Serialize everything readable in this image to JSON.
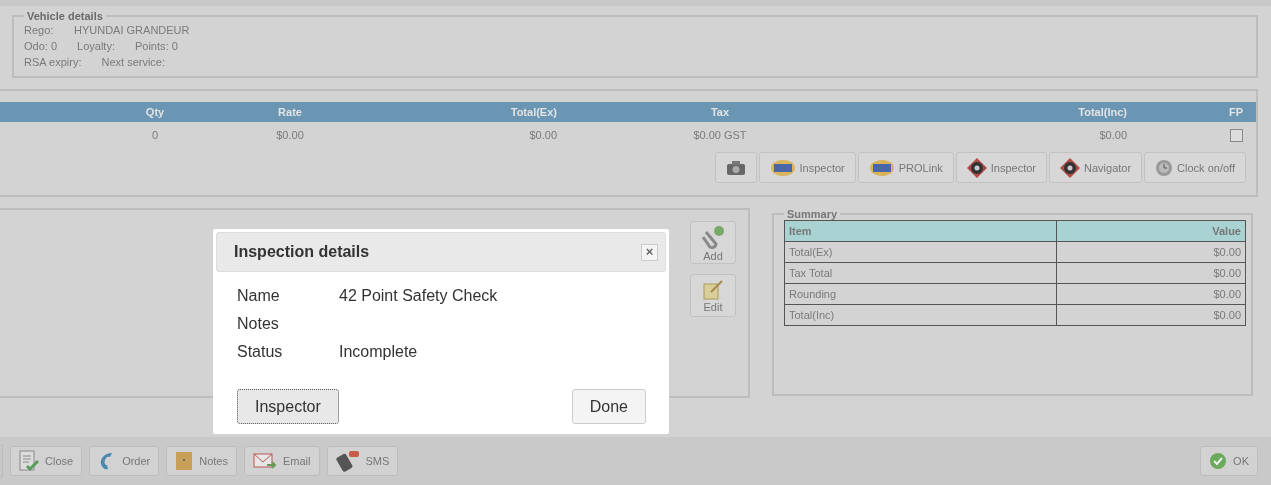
{
  "vehicle_details": {
    "title": "Vehicle details",
    "lines": [
      [
        "Rego:",
        "HYUNDAI GRANDEUR"
      ],
      [
        "Odo: 0",
        "Loyalty:",
        "Points: 0"
      ],
      [
        "RSA expiry:",
        "Next service:"
      ]
    ]
  },
  "items": {
    "columns": [
      "Qty",
      "Rate",
      "Total(Ex)",
      "Tax",
      "Total(Inc)",
      "FP"
    ],
    "rows": [
      {
        "cells": [
          "0",
          "$0.00",
          "$0.00",
          "$0.00  GST",
          "$0.00"
        ],
        "fp_checked": false
      }
    ],
    "toolbar": [
      {
        "kind": "camera"
      },
      {
        "kind": "gpc",
        "label": "Inspector"
      },
      {
        "kind": "gpc",
        "label": "PROLink"
      },
      {
        "kind": "target",
        "label": "Inspector"
      },
      {
        "kind": "target",
        "label": "Navigator"
      },
      {
        "kind": "clock",
        "label": "Clock on/off"
      }
    ]
  },
  "side_buttons": [
    {
      "kind": "add",
      "label": "Add"
    },
    {
      "kind": "edit",
      "label": "Edit"
    }
  ],
  "summary": {
    "title": "Summary",
    "columns": [
      "Item",
      "Value"
    ],
    "rows": [
      [
        "Total(Ex)",
        "$0.00"
      ],
      [
        "Tax Total",
        "$0.00"
      ],
      [
        "Rounding",
        "$0.00"
      ],
      [
        "Total(Inc)",
        "$0.00"
      ]
    ]
  },
  "bottom_bar": {
    "buttons": [
      {
        "kind": "close",
        "label": "Close"
      },
      {
        "kind": "order",
        "label": "Order"
      },
      {
        "kind": "notes",
        "label": "Notes"
      },
      {
        "kind": "email",
        "label": "Email"
      },
      {
        "kind": "sms",
        "label": "SMS"
      }
    ],
    "ok": {
      "label": "OK"
    }
  },
  "dialog": {
    "title": "Inspection details",
    "close": "×",
    "fields": [
      {
        "label": "Name",
        "value": "42 Point Safety Check"
      },
      {
        "label": "Notes"
      },
      {
        "label": "Status",
        "value": "Incomplete"
      }
    ],
    "buttons": [
      {
        "label": "Inspector",
        "focused": true
      },
      {
        "label": "Done",
        "focused": false
      }
    ]
  }
}
